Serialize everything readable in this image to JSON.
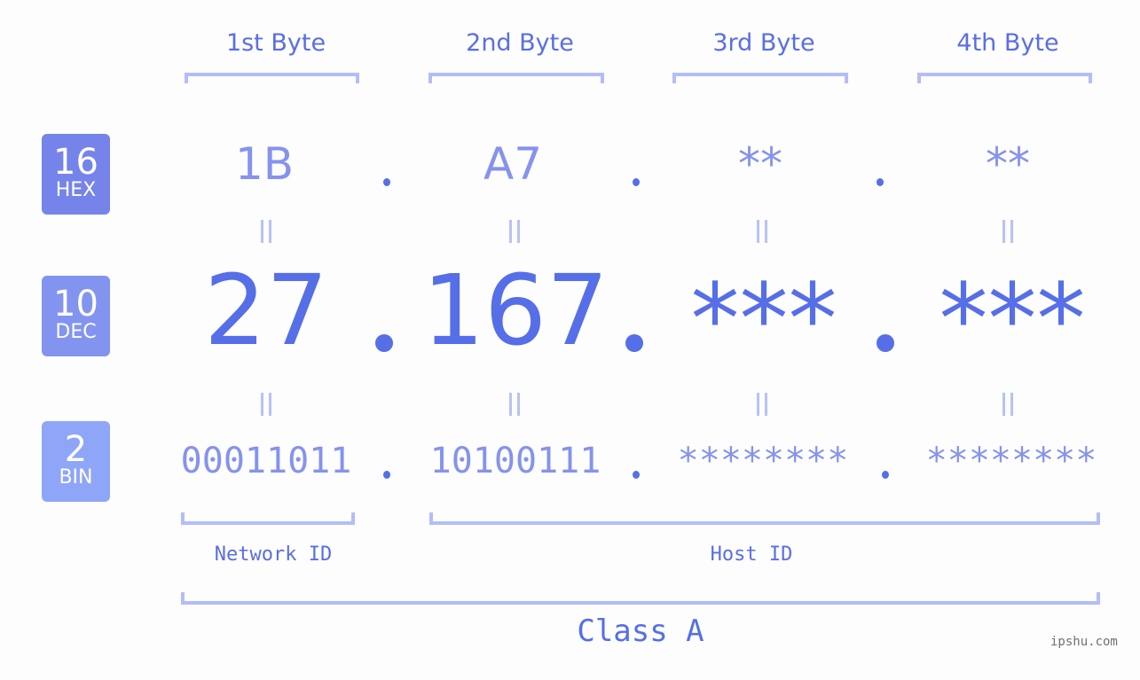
{
  "bytes": [
    {
      "header": "1st Byte",
      "hex": "1B",
      "dec": "27",
      "bin": "00011011"
    },
    {
      "header": "2nd Byte",
      "hex": "A7",
      "dec": "167",
      "bin": "10100111"
    },
    {
      "header": "3rd Byte",
      "hex": "**",
      "dec": "***",
      "bin": "********"
    },
    {
      "header": "4th Byte",
      "hex": "**",
      "dec": "***",
      "bin": "********"
    }
  ],
  "bases": {
    "hex": {
      "num": "16",
      "label": "HEX",
      "color": "#7583ea"
    },
    "dec": {
      "num": "10",
      "label": "DEC",
      "color": "#8394f0"
    },
    "bin": {
      "num": "2",
      "label": "BIN",
      "color": "#8fa6f8"
    }
  },
  "segments": {
    "network": "Network ID",
    "host": "Host ID",
    "class": "Class A"
  },
  "watermark": "ipshu.com",
  "colors": {
    "accent": "#566ee8",
    "light_text": "#8592ee",
    "bracket": "#b3bdf7",
    "equals": "#b8c2f4",
    "background": "#fcfdfc"
  }
}
